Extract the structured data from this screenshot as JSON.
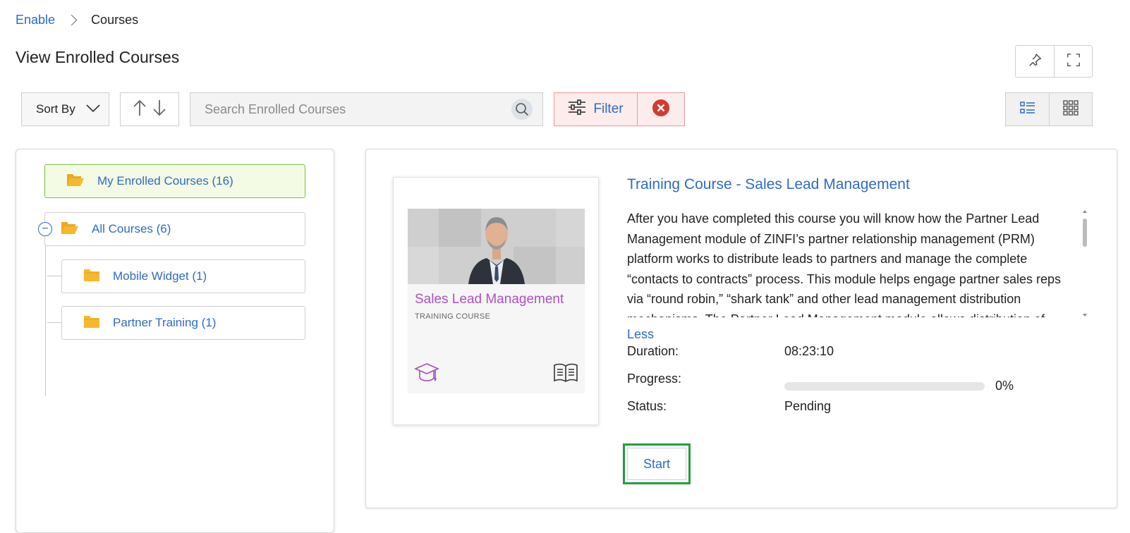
{
  "breadcrumb": {
    "root": "Enable",
    "current": "Courses"
  },
  "page": {
    "title": "View Enrolled Courses"
  },
  "toolbar": {
    "sort_label": "Sort By",
    "search_placeholder": "Search Enrolled Courses",
    "filter_label": "Filter"
  },
  "tree": {
    "root": {
      "label": "My Enrolled Courses (16)"
    },
    "all": {
      "label": "All Courses (6)"
    },
    "children": [
      {
        "label": "Mobile Widget (1)"
      },
      {
        "label": "Partner Training (1)"
      }
    ]
  },
  "course": {
    "title": "Training Course - Sales Lead Management",
    "thumb_title": "Sales Lead Management",
    "thumb_subtitle": "TRAINING COURSE",
    "description": "After you have completed this course you will know how the Partner Lead Management module of ZINFI’s partner relationship management (PRM) platform works to distribute leads to partners and manage the complete “contacts to contracts” process. This module helps engage partner sales reps via “round robin,” “shark tank” and other lead management distribution mechanisms. The Partner Lead Management module allows distribution of",
    "less_label": "Less",
    "duration_label": "Duration:",
    "duration_value": "08:23:10",
    "progress_label": "Progress:",
    "progress_value": 0,
    "progress_text": "0%",
    "status_label": "Status:",
    "status_value": "Pending",
    "start_label": "Start"
  },
  "colors": {
    "link": "#2f6bc4",
    "folder": "#f5b82e",
    "active_bg": "#f4fbe4",
    "active_border": "#7bc043",
    "filter_bg": "#fdecec",
    "clear_red": "#d23b2e",
    "start_highlight": "#1ea042",
    "thumb_title": "#b04fc6"
  }
}
